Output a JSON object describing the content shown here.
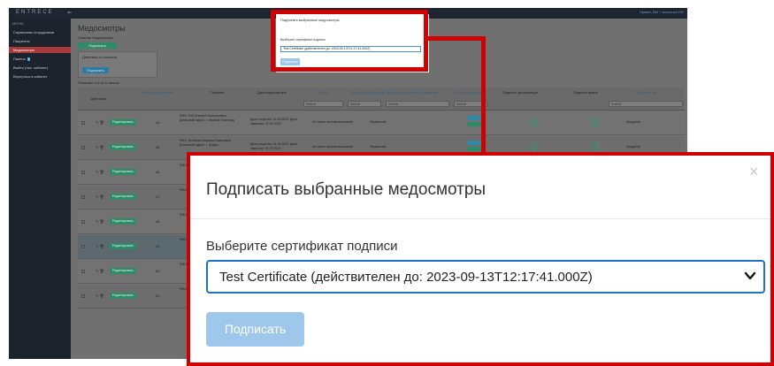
{
  "app": {
    "logo": "ENTRECE",
    "user_link": "Привет, ВМ + заполнен НО",
    "sidebar": {
      "title": "МЕНЮ",
      "items": [
        {
          "label": "Справочник сотрудников"
        },
        {
          "label": "Пациенты"
        },
        {
          "label": "Медосмотры"
        },
        {
          "label": "Пакеты",
          "badge": "1"
        },
        {
          "label": "Выйти (лич. кабинет)"
        },
        {
          "label": "Вернуться в кабинет"
        }
      ]
    },
    "page_title": "Медосмотры",
    "breadcrumb": "Главная   Медосмотры",
    "sign_selected_button": "Подписать медосмотры",
    "actions_box": {
      "label": "Действия со списком",
      "button": "Подписать"
    },
    "count_text": "Показано 1-8 из 8 записи",
    "table": {
      "headers": [
        "Действия",
        "Номер медосмотра",
        "Пациент",
        "Дата медосмотра",
        "Статус",
        "Порядок обращения",
        "Автор и предоставить сведения",
        "Статус выгрузки",
        "Подпись организации",
        "Подпись врача",
        "Организация"
      ],
      "filter_placeholder": "Любой",
      "row_button": "Редактировать",
      "row_status": "Не имеет противопоказаний",
      "row_type": "Первичный",
      "row_org": "Медцентр",
      "rows": [
        {
          "num": "44",
          "patient": "ФИО: Бой Алексей Анатольевич; Домашний адрес: г. Нижний Новгород",
          "dates": "Дата открытия: 31.03.2023; Дата закрытия: 31.03.2023"
        },
        {
          "num": "45",
          "patient": "ФИО: Игнатова Марина Романовна; Домашний адрес: г. Гродно",
          "dates": "Дата открытия: 31.03.2023; Дата закрытия: 31.03.2023"
        },
        {
          "num": "46",
          "patient": "ФИО: Домашний адрес:",
          "dates": ""
        },
        {
          "num": "47",
          "patient": "ФИО: Домашний адрес:",
          "dates": ""
        },
        {
          "num": "48",
          "patient": "ФИО: Домашний адрес:",
          "dates": ""
        },
        {
          "num": "49",
          "patient": "ФИО: Домашний адрес:",
          "dates": ""
        },
        {
          "num": "50",
          "patient": "ФИО: Домашний адрес:",
          "dates": ""
        },
        {
          "num": "51",
          "patient": "ФИО: Домашний адрес:",
          "dates": ""
        }
      ]
    }
  },
  "dialog": {
    "title": "Подписать выбранные медосмотры",
    "close_icon": "×",
    "certificate_label": "Выберите сертификат подписи",
    "certificate_value": "Test Certificate (действителен до: 2023-09-13T12:17:41.000Z)",
    "submit_label": "Подписать"
  },
  "colors": {
    "highlight": "#d10000",
    "select_border": "#1a73c7",
    "submit_disabled": "#9fc7ec"
  }
}
